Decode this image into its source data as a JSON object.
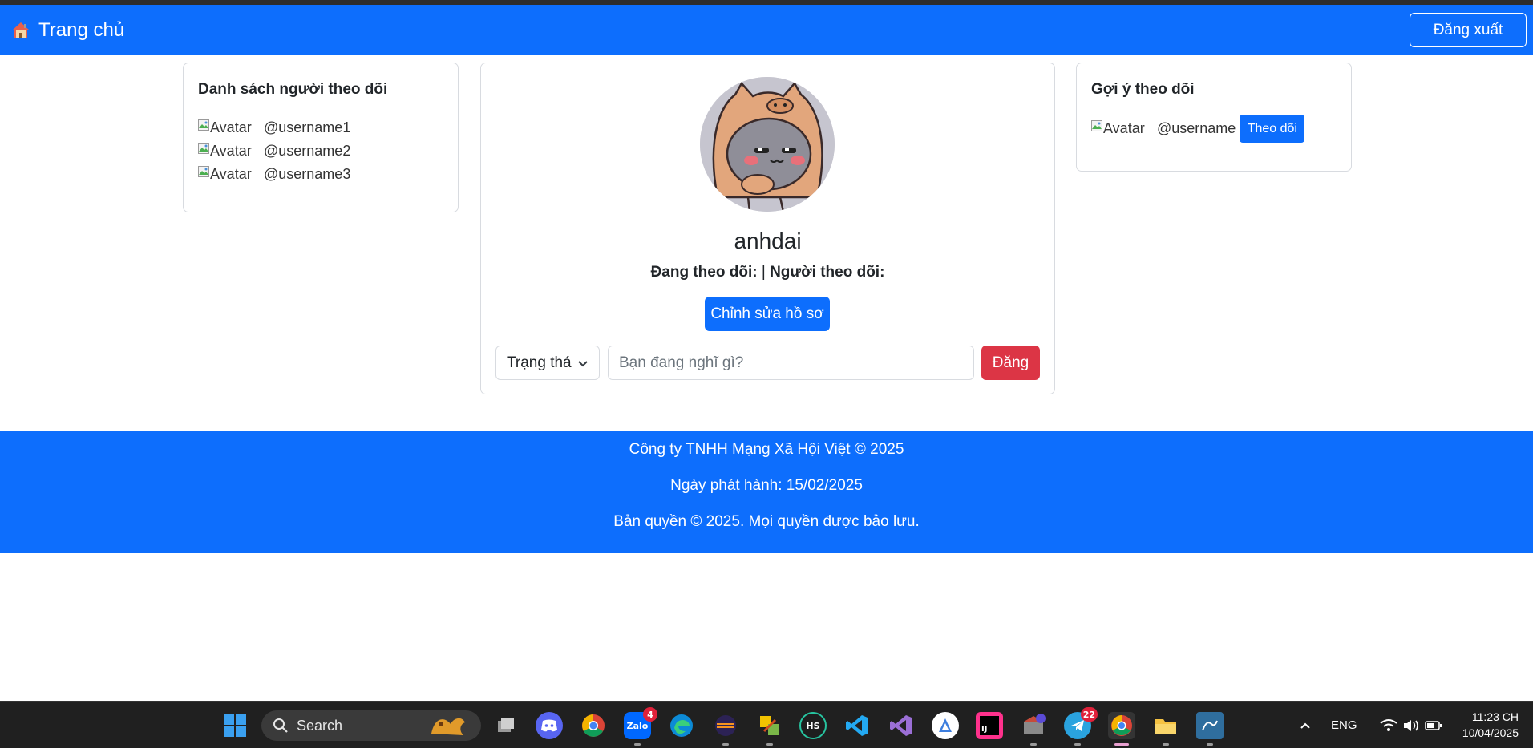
{
  "nav": {
    "brand_label": "Trang chủ",
    "logout_label": "Đăng xuất"
  },
  "following": {
    "title": "Danh sách người theo dõi",
    "items": [
      {
        "avatar_alt": "Avatar",
        "username": "@username1"
      },
      {
        "avatar_alt": "Avatar",
        "username": "@username2"
      },
      {
        "avatar_alt": "Avatar",
        "username": "@username3"
      }
    ]
  },
  "profile": {
    "name": "anhdai",
    "following_label": "Đang theo dõi:",
    "separator": "|",
    "followers_label": "Người theo dõi:",
    "edit_label": "Chỉnh sửa hồ sơ",
    "status_select_value": "Trạng thá",
    "post_placeholder": "Bạn đang nghĩ gì?",
    "post_button": "Đăng"
  },
  "suggest": {
    "title": "Gợi ý theo dõi",
    "avatar_alt": "Avatar",
    "username": "@username",
    "follow_label": "Theo dõi"
  },
  "footer": {
    "line1": "Công ty TNHH Mạng Xã Hội Việt © 2025",
    "line2": "Ngày phát hành: 15/02/2025",
    "line3": "Bản quyền © 2025. Mọi quyền được bảo lưu."
  },
  "taskbar": {
    "search_label": "Search",
    "zalo_badge": "4",
    "telegram_badge": "22",
    "language": "ENG",
    "time": "11:23 CH",
    "date": "10/04/2025"
  },
  "colors": {
    "primary": "#0d6efd",
    "danger": "#dc3545",
    "taskbar": "#202020"
  }
}
